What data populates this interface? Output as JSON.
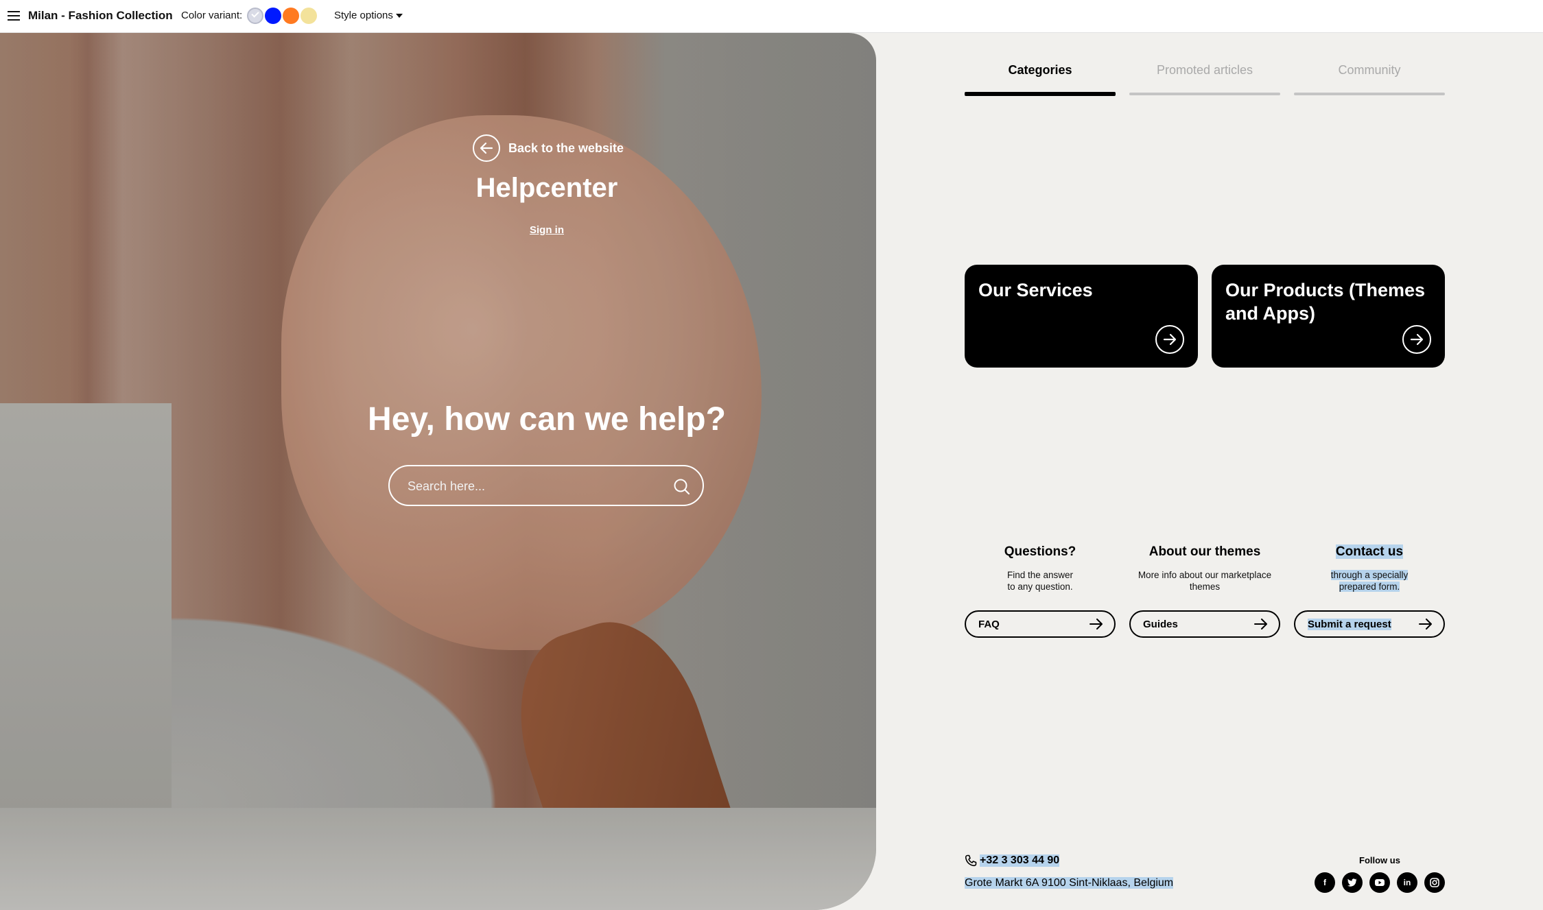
{
  "topbar": {
    "title": "Milan - Fashion Collection",
    "color_label": "Color variant:",
    "swatches": [
      "#d9dbe6",
      "#0019ff",
      "#ff7a21",
      "#f3e29b"
    ],
    "style_options": "Style options"
  },
  "hero": {
    "back_label": "Back to the website",
    "title": "Helpcenter",
    "signin": "Sign in",
    "question": "Hey, how can we help?",
    "search_placeholder": "Search here..."
  },
  "tabs": [
    {
      "label": "Categories",
      "active": true
    },
    {
      "label": "Promoted articles",
      "active": false
    },
    {
      "label": "Community",
      "active": false
    }
  ],
  "cards": [
    {
      "title": "Our Services"
    },
    {
      "title": "Our Products (Themes and Apps)"
    }
  ],
  "info": [
    {
      "heading": "Questions?",
      "desc_1": "Find the answer",
      "desc_2": "to any question.",
      "button": "FAQ"
    },
    {
      "heading": "About our themes",
      "desc_1": "More info about our marketplace",
      "desc_2": "themes",
      "button": "Guides"
    },
    {
      "heading": "Contact us",
      "desc_1": "through a specially",
      "desc_2": "prepared form.",
      "button": "Submit a request"
    }
  ],
  "footer": {
    "phone": "+32 3 303 44 90",
    "address": "Grote Markt 6A 9100 Sint-Niklaas, Belgium",
    "follow": "Follow us",
    "social_icons": [
      "facebook-icon",
      "twitter-icon",
      "youtube-icon",
      "linkedin-icon",
      "instagram-icon"
    ]
  }
}
